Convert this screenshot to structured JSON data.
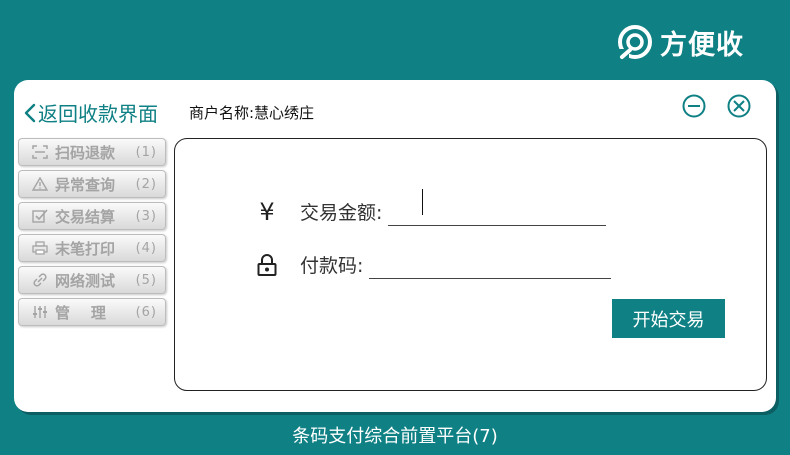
{
  "brand": {
    "name": "方便收",
    "icon": "brand-logo-icon"
  },
  "header": {
    "back_label": "返回收款界面",
    "merchant": "商户名称:慧心绣庄",
    "minimize_icon": "minimize-circle-icon",
    "close_icon": "close-circle-icon"
  },
  "sidebar": {
    "items": [
      {
        "label": "扫码退款",
        "key": "(1)",
        "icon": "scan-icon"
      },
      {
        "label": "异常查询",
        "key": "(2)",
        "icon": "warning-icon"
      },
      {
        "label": "交易结算",
        "key": "(3)",
        "icon": "checklist-icon"
      },
      {
        "label": "末笔打印",
        "key": "(4)",
        "icon": "printer-icon"
      },
      {
        "label": "网络测试",
        "key": "(5)",
        "icon": "link-icon"
      },
      {
        "label": "管    理",
        "key": "(6)",
        "icon": "sliders-icon"
      }
    ]
  },
  "form": {
    "amount_icon": "yuan-icon",
    "amount_symbol": "¥",
    "amount_label": "交易金额:",
    "amount_value": "",
    "code_icon": "lock-icon",
    "code_label": "付款码:",
    "code_value": "",
    "start_label": "开始交易"
  },
  "footer": {
    "text": "条码支付综合前置平台(7)"
  },
  "colors": {
    "primary": "#0f8084",
    "menu_text": "#a4a4a4"
  }
}
